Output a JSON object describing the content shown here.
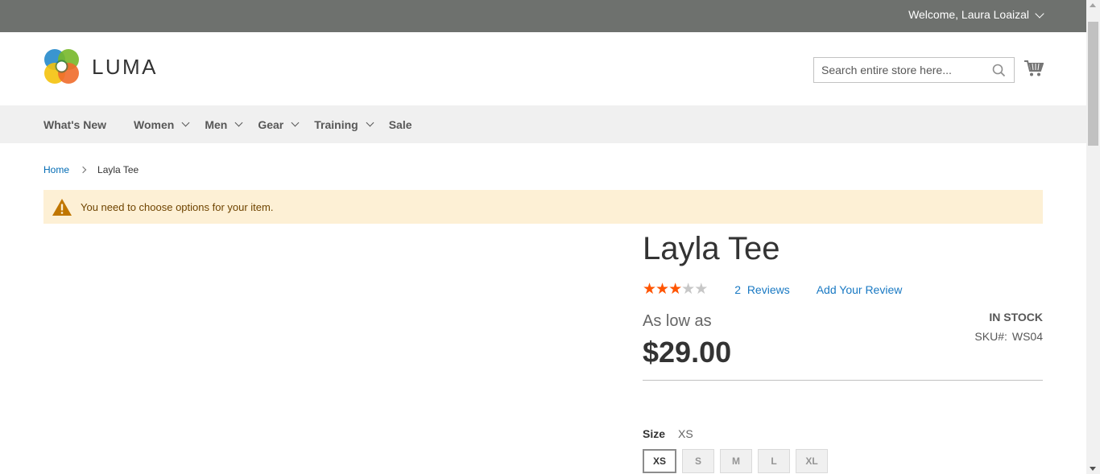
{
  "header": {
    "welcome": "Welcome, Laura Loaizal",
    "logo_text": "LUMA",
    "search_placeholder": "Search entire store here..."
  },
  "nav": {
    "items": [
      {
        "label": "What's New",
        "has_submenu": false
      },
      {
        "label": "Women",
        "has_submenu": true
      },
      {
        "label": "Men",
        "has_submenu": true
      },
      {
        "label": "Gear",
        "has_submenu": true
      },
      {
        "label": "Training",
        "has_submenu": true
      },
      {
        "label": "Sale",
        "has_submenu": false
      }
    ]
  },
  "breadcrumb": {
    "home": "Home",
    "current": "Layla Tee"
  },
  "message": {
    "text": "You need to choose options for your item."
  },
  "product": {
    "title": "Layla Tee",
    "rating": {
      "value": 3,
      "max": 5
    },
    "review_count": "2",
    "reviews_label": "Reviews",
    "add_review": "Add Your Review",
    "price_prefix": "As low as",
    "price": "$29.00",
    "stock": "In stock",
    "sku_label": "SKU#:",
    "sku": "WS04",
    "size_label": "Size",
    "size_selected": "XS",
    "sizes": [
      "XS",
      "S",
      "M",
      "L",
      "XL"
    ]
  },
  "colors": {
    "topbar": "#6e716e",
    "link": "#1979c3",
    "star": "#ff5501",
    "message_bg": "#fdf0d5"
  }
}
